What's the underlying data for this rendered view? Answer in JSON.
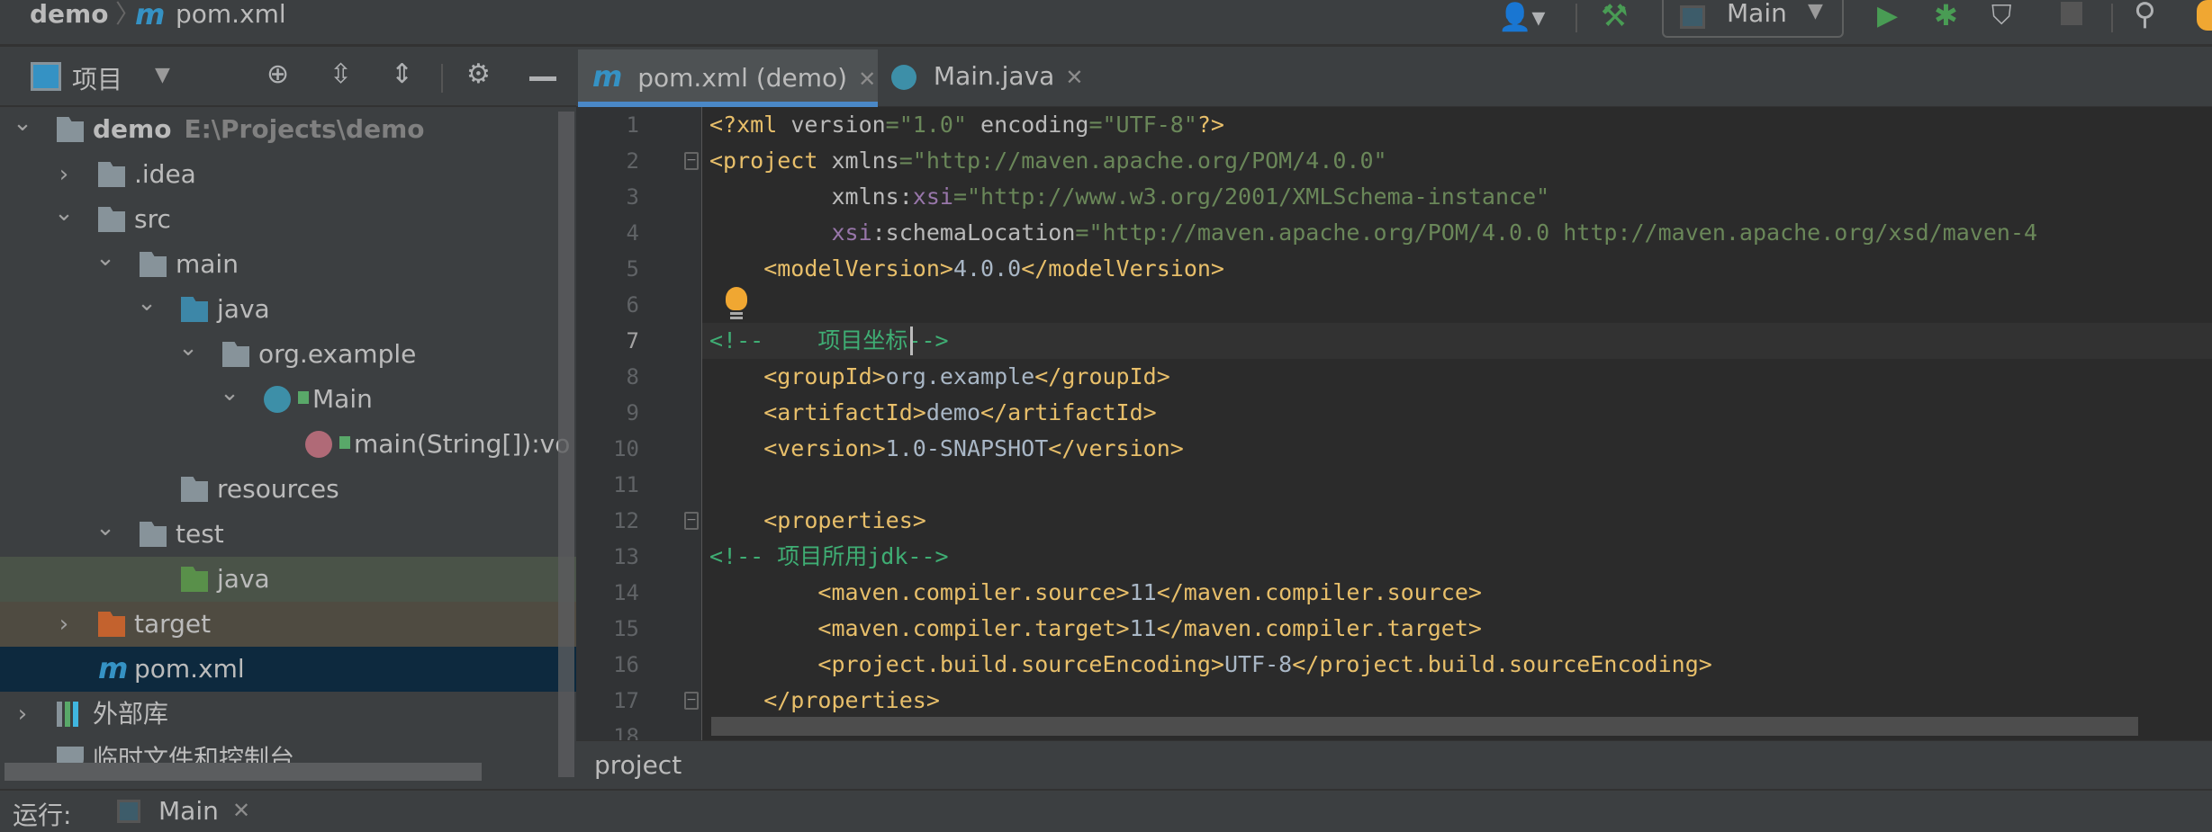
{
  "breadcrumb": {
    "project": "demo",
    "file": "pom.xml",
    "file_icon": "maven-icon"
  },
  "toolbar": {
    "run_config": "Main",
    "icons": [
      "user-icon",
      "build-hammer-icon",
      "run-icon",
      "debug-icon",
      "coverage-icon",
      "stop-icon",
      "search-icon",
      "update-icon"
    ]
  },
  "tool_window": {
    "title": "项目",
    "icons": [
      "locate-icon",
      "expand-all-icon",
      "collapse-all-icon",
      "gear-icon",
      "hide-icon"
    ]
  },
  "tabs": [
    {
      "label": "pom.xml (demo)",
      "active": true,
      "icon": "maven-icon"
    },
    {
      "label": "Main.java",
      "active": false,
      "icon": "java-class-icon"
    }
  ],
  "tree": [
    {
      "label": "demo",
      "hint": "E:\\Projects\\demo",
      "level": 0,
      "arrow": "down",
      "icon": "module",
      "bold": true
    },
    {
      "label": ".idea",
      "level": 1,
      "arrow": "right",
      "icon": "folder"
    },
    {
      "label": "src",
      "level": 1,
      "arrow": "down",
      "icon": "folder"
    },
    {
      "label": "main",
      "level": 2,
      "arrow": "down",
      "icon": "folder"
    },
    {
      "label": "java",
      "level": 3,
      "arrow": "down",
      "icon": "source-folder"
    },
    {
      "label": "org.example",
      "level": 4,
      "arrow": "down",
      "icon": "package"
    },
    {
      "label": "Main",
      "level": 5,
      "arrow": "down",
      "icon": "class"
    },
    {
      "label": "main(String[]):vo",
      "level": 6,
      "arrow": "",
      "icon": "method"
    },
    {
      "label": "resources",
      "level": 3,
      "arrow": "",
      "icon": "resources-folder"
    },
    {
      "label": "test",
      "level": 2,
      "arrow": "down",
      "icon": "folder"
    },
    {
      "label": "java",
      "level": 3,
      "arrow": "",
      "icon": "test-folder",
      "highlight": "#4a5348"
    },
    {
      "label": "target",
      "level": 1,
      "arrow": "right",
      "icon": "excluded-folder",
      "highlight": "#4f4b41"
    },
    {
      "label": "pom.xml",
      "level": 1,
      "arrow": "",
      "icon": "maven",
      "highlight": "#0d293e",
      "selected": true
    },
    {
      "label": "外部库",
      "level": 0,
      "arrow": "right",
      "icon": "library"
    },
    {
      "label": "临时文件和控制台",
      "level": 0,
      "arrow": "",
      "icon": "scratch"
    }
  ],
  "editor": {
    "current_line": 7,
    "lines": [
      [
        [
          "<?xml ",
          "tag"
        ],
        [
          "version",
          "attr"
        ],
        [
          "=\"1.0\" ",
          "val"
        ],
        [
          "encoding",
          "attr"
        ],
        [
          "=\"UTF-8\"",
          "val"
        ],
        [
          "?>",
          "tag"
        ]
      ],
      [
        [
          "<project ",
          "tag"
        ],
        [
          "xmlns",
          "attr"
        ],
        [
          "=\"http://maven.apache.org/POM/4.0.0\"",
          "val"
        ]
      ],
      [
        [
          "         xmlns:",
          "attr"
        ],
        [
          "xsi",
          "ns"
        ],
        [
          "=\"http://www.w3.org/2001/XMLSchema-instance\"",
          "val"
        ]
      ],
      [
        [
          "         ",
          "txt"
        ],
        [
          "xsi",
          "ns"
        ],
        [
          ":schemaLocation",
          "attr"
        ],
        [
          "=\"http://maven.apache.org/POM/4.0.0 http://maven.apache.org/xsd/maven-4",
          "val"
        ]
      ],
      [
        [
          "    <modelVersion>",
          "tag"
        ],
        [
          "4.0.0",
          "txt"
        ],
        [
          "</modelVersion>",
          "tag"
        ]
      ],
      [],
      [
        [
          "<!--    项目坐标-->",
          "cm"
        ]
      ],
      [
        [
          "    <groupId>",
          "tag"
        ],
        [
          "org.example",
          "txt"
        ],
        [
          "</groupId>",
          "tag"
        ]
      ],
      [
        [
          "    <artifactId>",
          "tag"
        ],
        [
          "demo",
          "txt"
        ],
        [
          "</artifactId>",
          "tag"
        ]
      ],
      [
        [
          "    <version>",
          "tag"
        ],
        [
          "1.0-SNAPSHOT",
          "txt"
        ],
        [
          "</version>",
          "tag"
        ]
      ],
      [],
      [
        [
          "    <properties>",
          "tag"
        ]
      ],
      [
        [
          "<!-- 项目所用jdk-->",
          "cm"
        ]
      ],
      [
        [
          "        <maven.compiler.source>",
          "tag"
        ],
        [
          "11",
          "txt"
        ],
        [
          "</maven.compiler.source>",
          "tag"
        ]
      ],
      [
        [
          "        <maven.compiler.target>",
          "tag"
        ],
        [
          "11",
          "txt"
        ],
        [
          "</maven.compiler.target>",
          "tag"
        ]
      ],
      [
        [
          "        <project.build.sourceEncoding>",
          "tag"
        ],
        [
          "UTF-8",
          "txt"
        ],
        [
          "</project.build.sourceEncoding>",
          "tag"
        ]
      ],
      [
        [
          "    </properties>",
          "tag"
        ]
      ],
      []
    ]
  },
  "status_breadcrumb": "project",
  "run_panel": {
    "label": "运行:",
    "tab": "Main"
  }
}
